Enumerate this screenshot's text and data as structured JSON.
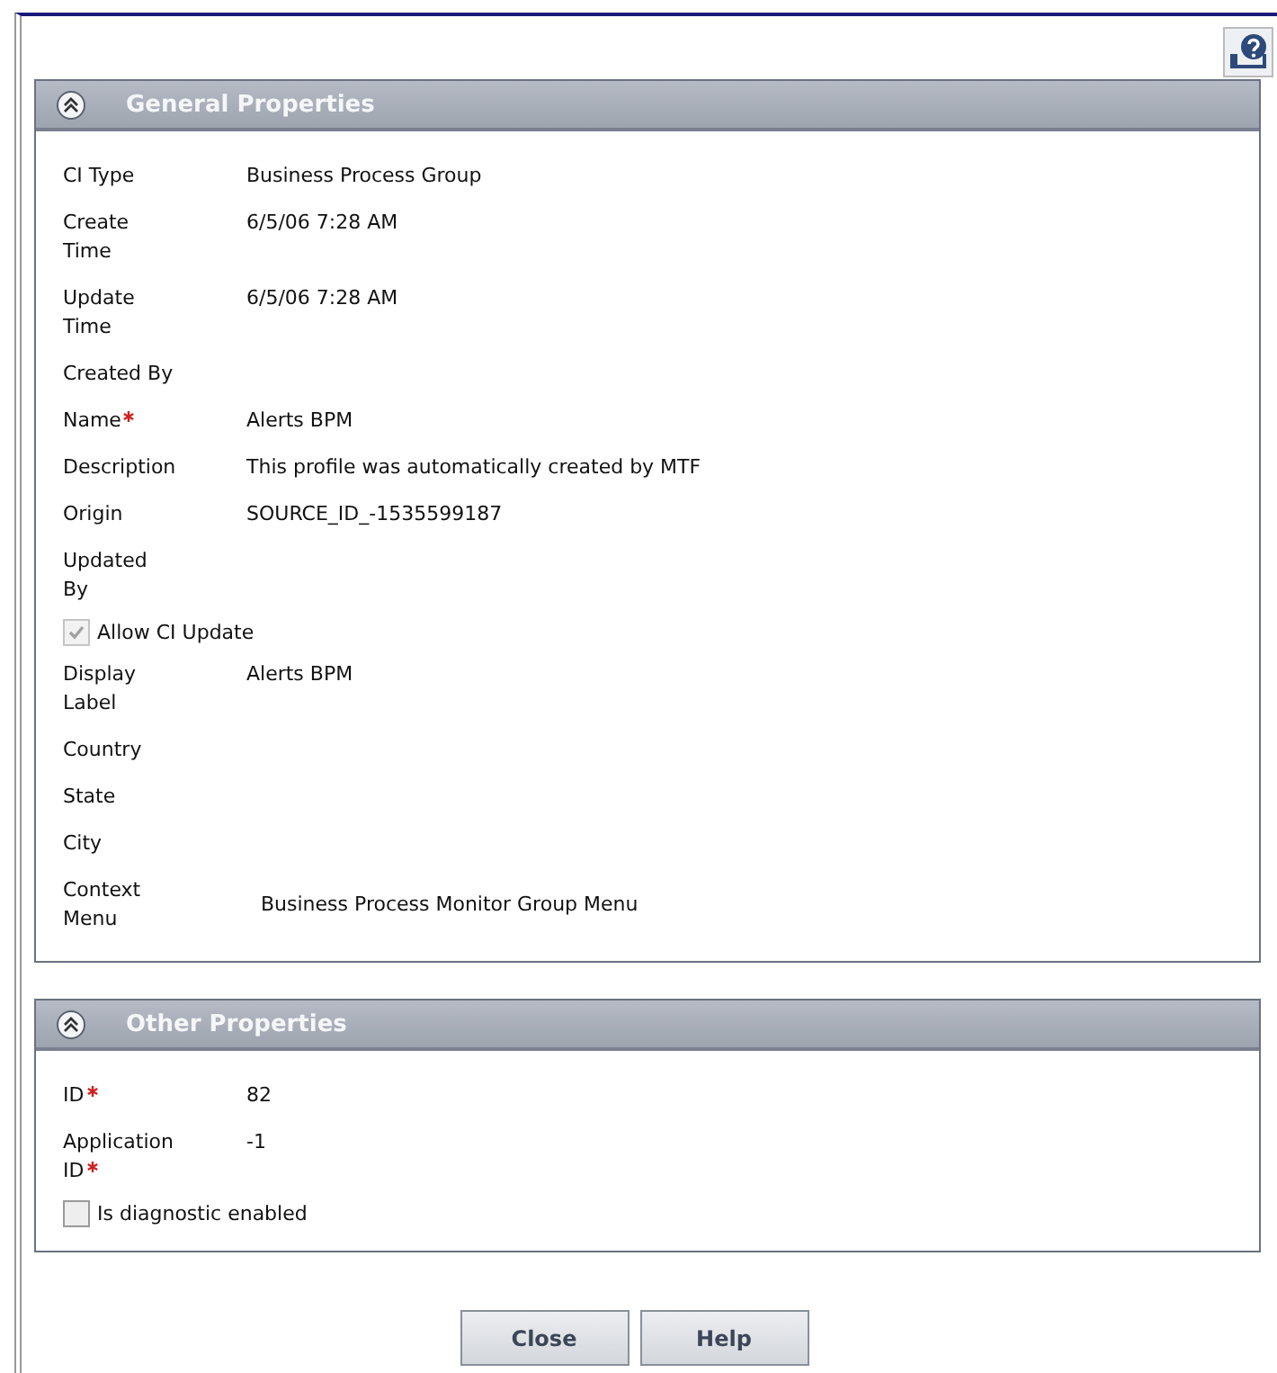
{
  "panels": [
    {
      "title": "General Properties",
      "expanded": true,
      "rows": [
        {
          "kind": "field",
          "label": "CI Type",
          "value": "Business Process Group",
          "required": false
        },
        {
          "kind": "field",
          "label": "Create Time",
          "value": "6/5/06 7:28 AM",
          "required": false
        },
        {
          "kind": "field",
          "label": "Update Time",
          "value": "6/5/06 7:28 AM",
          "required": false
        },
        {
          "kind": "field",
          "label": "Created By",
          "required": false
        },
        {
          "kind": "field",
          "label": "Name",
          "value": "Alerts BPM",
          "required": true
        },
        {
          "kind": "field",
          "label": "Description",
          "value": "This profile was automatically created by MTF",
          "required": false
        },
        {
          "kind": "field",
          "label": "Origin",
          "value": "SOURCE_ID_-1535599187",
          "required": false
        },
        {
          "kind": "field",
          "label": "Updated By",
          "required": false
        },
        {
          "kind": "checkbox",
          "label": "Allow CI Update",
          "checked": true,
          "disabled": true
        },
        {
          "kind": "field",
          "label": "Display Label",
          "value": "Alerts BPM",
          "required": false
        },
        {
          "kind": "field",
          "label": "Country",
          "required": false
        },
        {
          "kind": "field",
          "label": "State",
          "required": false
        },
        {
          "kind": "field",
          "label": "City",
          "required": false
        },
        {
          "kind": "menu",
          "label": "Context Menu",
          "value": "Business Process Monitor Group Menu",
          "required": false
        }
      ]
    },
    {
      "title": "Other Properties",
      "expanded": true,
      "rows": [
        {
          "kind": "field",
          "label": "ID",
          "value": "82",
          "required": true
        },
        {
          "kind": "field",
          "label": "Application ID",
          "value": "-1",
          "required": true
        },
        {
          "kind": "checkbox",
          "label": "Is diagnostic enabled",
          "checked": false,
          "disabled": false
        }
      ]
    }
  ],
  "buttons": [
    "Close",
    "Help"
  ]
}
